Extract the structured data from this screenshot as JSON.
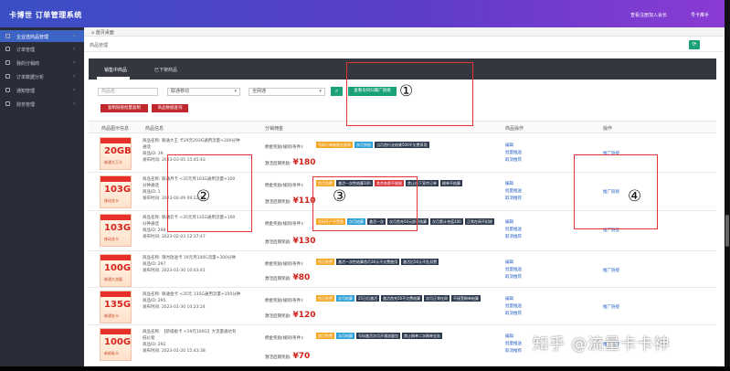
{
  "app": {
    "title": "卡博世 订单管理系统",
    "notice": "查看注册加入会长",
    "user": "号卡推手"
  },
  "sidebar": {
    "items": [
      {
        "label": "企业选商品管理",
        "active": true
      },
      {
        "label": "订单管理"
      },
      {
        "label": "我的分销商"
      },
      {
        "label": "订单数据分析"
      },
      {
        "label": "通知管理"
      },
      {
        "label": "财务管理"
      }
    ]
  },
  "tabs": {
    "home": "首页桌面"
  },
  "breadcrumb": "商品管理",
  "panel": {
    "tabs": [
      "销售中商品",
      "已下架商品"
    ]
  },
  "filters": {
    "name_placeholder": "商品名",
    "operator": "联通移动",
    "province": "全网通"
  },
  "buttons": {
    "batch_promo": "查看号码归属广链接",
    "export_orders": "复制链接批量复制",
    "export_products": "商品数据查询"
  },
  "table": {
    "headers": [
      "商品图示信息",
      "商品信息",
      "分销佣金",
      "商品操作",
      "操作"
    ],
    "commission_label": "佣金奖励(规则/条件):",
    "reward_label": "激活后期奖励:",
    "ops": [
      "编辑",
      "批量推送",
      "取消推荐"
    ],
    "promo": "推广链接",
    "rows": [
      {
        "img_big": "20GB",
        "img_small": "联通大王卡",
        "lines": [
          "商品名称: 联通大王 卡29元203G通用流量+200分钟",
          "通话",
          "商品ID: 39",
          "发布时间: 2023-03-05 15:45:43"
        ],
        "tags": [
          {
            "t": "号码订单结果全部享",
            "c": "y"
          },
          {
            "t": "次月到账",
            "c": "b"
          },
          {
            "t": "当月首行业结果500不欠费享用",
            "c": "d"
          }
        ],
        "reward": "180"
      },
      {
        "img_big": "103G",
        "img_small": "移动花卡",
        "lines": [
          "商品名称: 联通月卡 <35元月103G通用流量+100",
          "分钟通话",
          "商品ID: 1",
          "发布时间: 2023-02-09 09:22:11"
        ],
        "tags": [
          {
            "t": "首月免费",
            "c": "y"
          },
          {
            "t": "激活一次性结算100",
            "c": "d"
          },
          {
            "t": "其余各群不限制",
            "c": "r"
          },
          {
            "t": "禁止线下宣传订单",
            "c": "d"
          },
          {
            "t": "刷单不结算",
            "c": "d"
          }
        ],
        "reward": "110"
      },
      {
        "img_big": "103G",
        "img_small": "移动花卡",
        "lines": [
          "商品名称: 联通云卡 <35元月135G通用流量+100",
          "分钟通话",
          "商品ID: 298",
          "发布时间: 2023-02-03 12:37:47"
        ],
        "tags": [
          {
            "t": "号码开户不受限",
            "c": "y"
          },
          {
            "t": "次月结算",
            "c": "b"
          },
          {
            "t": "激活一次",
            "c": "d"
          },
          {
            "t": "次月首充50元即可结算",
            "c": "d"
          },
          {
            "t": "次月累计充值100",
            "c": "d"
          },
          {
            "t": "正常在网不扣除",
            "c": "d"
          }
        ],
        "reward": "130"
      },
      {
        "img_big": "100G",
        "img_small": "联通大流量",
        "lines": [
          "商品名称: 限时放送卡 19元月100G流量+300分钟",
          "商品ID: 297",
          "发布时间: 2023-01-30 10:03:41"
        ],
        "tags": [
          {
            "t": "首月免费",
            "c": "y"
          },
          {
            "t": "激活一次性结算首月30元不欠费使用",
            "c": "d"
          },
          {
            "t": "激活后50元不乱扣费",
            "c": "d"
          }
        ],
        "reward": "80"
      },
      {
        "img_big": "135G",
        "img_small": "联通金卡",
        "lines": [
          "商品名称: 联通金卡 <35元 135G通用流量+100分钟",
          "商品ID: 295",
          "发布时间: 2023-01-30 10:23:24"
        ],
        "tags": [
          {
            "t": "首月免费",
            "c": "y"
          },
          {
            "t": "次月结算",
            "c": "b"
          },
          {
            "t": "25日后激活",
            "c": "d"
          },
          {
            "t": "激活首充50不欠费结算",
            "c": "d"
          },
          {
            "t": "次月正常在网",
            "c": "d"
          },
          {
            "t": "不接受刷单结算",
            "c": "d"
          }
        ],
        "reward": "120"
      },
      {
        "img_big": "100G",
        "img_small": "新纸板卡",
        "lines": [
          "商品名称: 【新纸板卡 <19元100G】大流量通达有",
          "低价套",
          "商品ID: 292",
          "发布时间: 2023-01-20 15:43:38"
        ],
        "tags": [
          {
            "t": "首月免费",
            "c": "y"
          },
          {
            "t": "次月结算",
            "c": "b"
          },
          {
            "t": "号码激活次月开通流量包",
            "c": "d"
          },
          {
            "t": "禁止刷单二次刷单业务",
            "c": "d"
          }
        ],
        "reward": "70"
      }
    ]
  },
  "annotations": [
    "①",
    "②",
    "③",
    "④"
  ],
  "watermark": "知乎 @流量卡卡神",
  "colors": {
    "header_start": "#3a4fc4",
    "header_end": "#8a3bd3",
    "sidebar": "#2a2d38",
    "accent_green": "#1aa179",
    "accent_red": "#c0272d",
    "price_red": "#d0231c",
    "annotation": "#e53333"
  }
}
